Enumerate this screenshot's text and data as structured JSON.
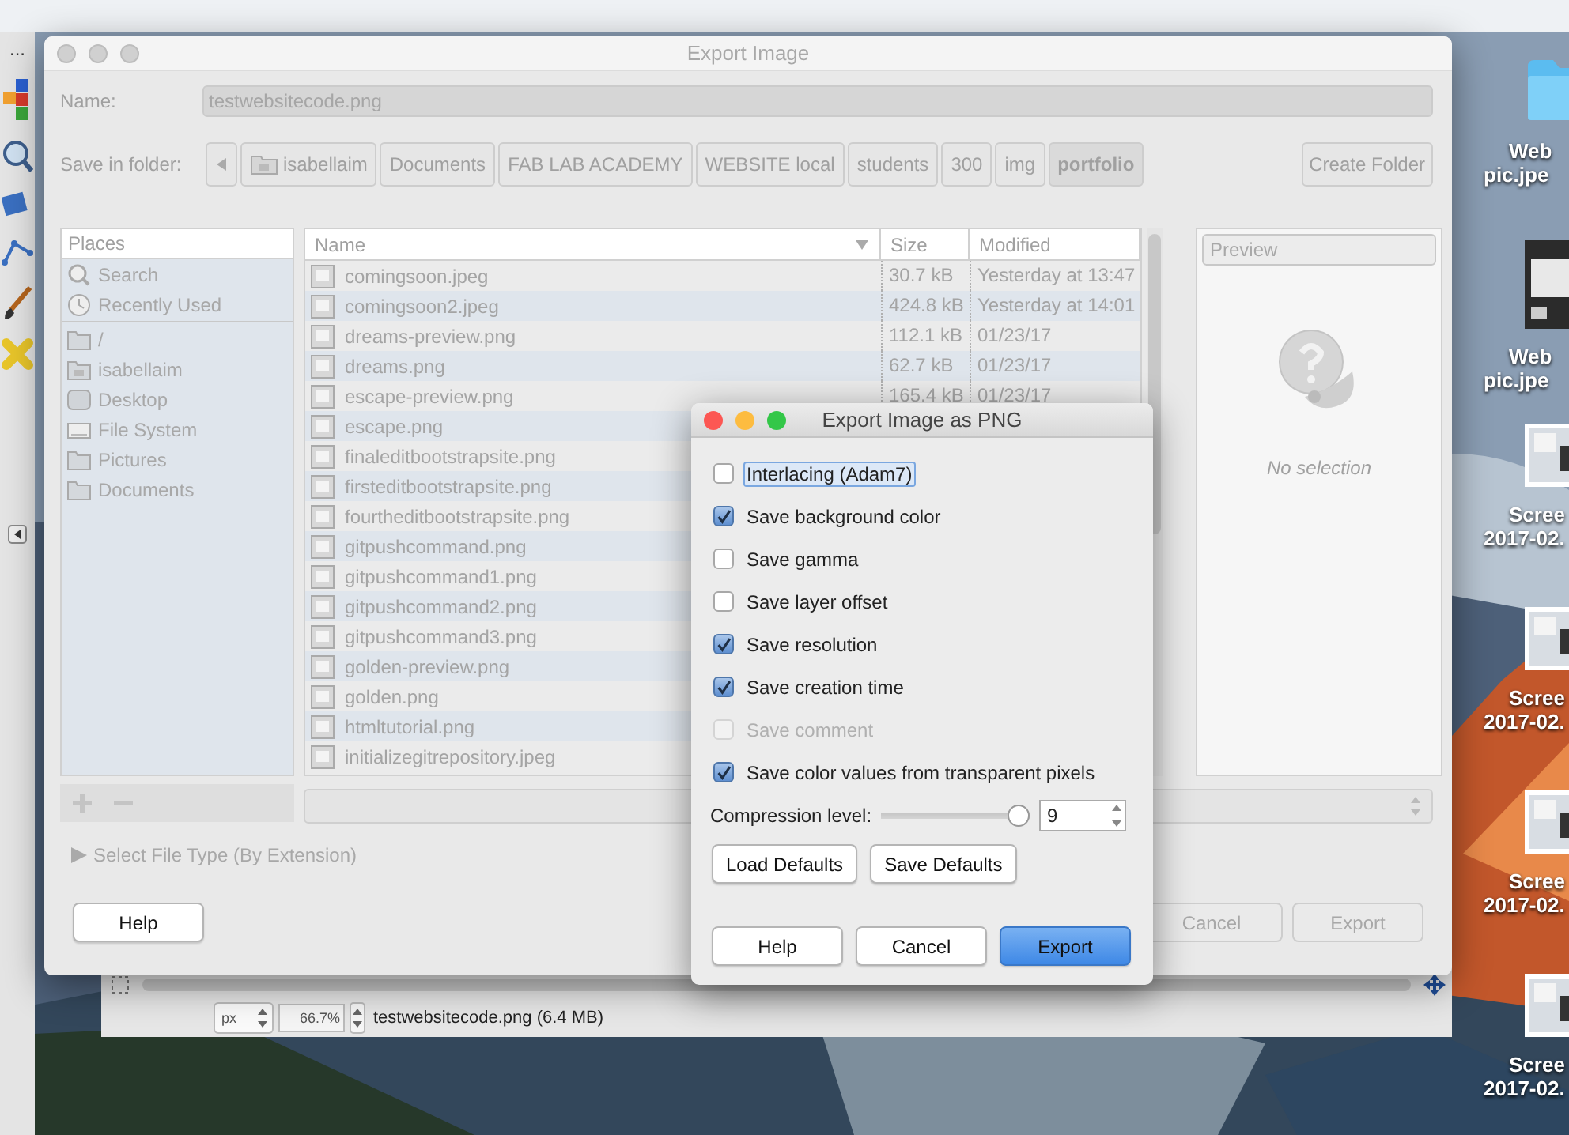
{
  "toolbox": {
    "overflow_label": "..."
  },
  "desktop_icons": [
    {
      "kind": "folder",
      "lines": [
        "Web",
        "pic.jpe"
      ]
    },
    {
      "kind": "dark",
      "lines": [
        "Web",
        "pic.jpe"
      ]
    },
    {
      "kind": "screenshot",
      "lines": [
        "Scree",
        "2017-02."
      ]
    },
    {
      "kind": "screenshot",
      "lines": [
        "Scree",
        "2017-02."
      ]
    },
    {
      "kind": "screenshot",
      "lines": [
        "Scree",
        "2017-02."
      ]
    },
    {
      "kind": "screenshot",
      "lines": [
        "Scree",
        "2017-02."
      ]
    }
  ],
  "image_window": {
    "unit": "px",
    "zoom": "66.7%",
    "status": "testwebsitecode.png (6.4 MB)"
  },
  "export_dialog": {
    "title": "Export Image",
    "name_label": "Name:",
    "name_value": "testwebsitecode.png",
    "folder_label": "Save in folder:",
    "path": [
      {
        "label": "isabellaim",
        "kind": "home",
        "selected": false
      },
      {
        "label": "Documents",
        "kind": "plain",
        "selected": false
      },
      {
        "label": "FAB LAB ACADEMY",
        "kind": "plain",
        "selected": false
      },
      {
        "label": "WEBSITE local",
        "kind": "plain",
        "selected": false
      },
      {
        "label": "students",
        "kind": "plain",
        "selected": false
      },
      {
        "label": "300",
        "kind": "plain",
        "selected": false
      },
      {
        "label": "img",
        "kind": "plain",
        "selected": false
      },
      {
        "label": "portfolio",
        "kind": "plain",
        "selected": true
      }
    ],
    "create_folder": "Create Folder",
    "places": {
      "title": "Places",
      "shortcuts": [
        {
          "label": "Search",
          "kind": "search"
        },
        {
          "label": "Recently Used",
          "kind": "recent"
        }
      ],
      "locations": [
        {
          "label": "/",
          "kind": "folder"
        },
        {
          "label": "isabellaim",
          "kind": "home"
        },
        {
          "label": "Desktop",
          "kind": "desktop"
        },
        {
          "label": "File System",
          "kind": "drive"
        },
        {
          "label": "Pictures",
          "kind": "folder"
        },
        {
          "label": "Documents",
          "kind": "folder"
        }
      ]
    },
    "files": {
      "columns": [
        "Name",
        "Size",
        "Modified"
      ],
      "rows": [
        {
          "name": "comingsoon.jpeg",
          "size": "30.7 kB",
          "modified": "Yesterday at 13:47"
        },
        {
          "name": "comingsoon2.jpeg",
          "size": "424.8 kB",
          "modified": "Yesterday at 14:01"
        },
        {
          "name": "dreams-preview.png",
          "size": "112.1 kB",
          "modified": "01/23/17"
        },
        {
          "name": "dreams.png",
          "size": "62.7 kB",
          "modified": "01/23/17"
        },
        {
          "name": "escape-preview.png",
          "size": "165.4 kB",
          "modified": "01/23/17"
        },
        {
          "name": "escape.png"
        },
        {
          "name": "finaleditbootstrapsite.png"
        },
        {
          "name": "firsteditbootstrapsite.png"
        },
        {
          "name": "fourtheditbootstrapsite.png"
        },
        {
          "name": "gitpushcommand.png"
        },
        {
          "name": "gitpushcommand1.png"
        },
        {
          "name": "gitpushcommand2.png"
        },
        {
          "name": "gitpushcommand3.png"
        },
        {
          "name": "golden-preview.png"
        },
        {
          "name": "golden.png"
        },
        {
          "name": "htmltutorial.png"
        },
        {
          "name": "initializegitrepository.jpeg"
        }
      ]
    },
    "preview": {
      "title": "Preview",
      "message": "No selection"
    },
    "file_type": {
      "label": "Select File Type (By Extension)",
      "expanded": false
    },
    "help": "Help",
    "cancel": "Cancel",
    "export": "Export"
  },
  "png_dialog": {
    "title": "Export Image as PNG",
    "options": [
      {
        "label": "Interlacing (Adam7)",
        "checked": false,
        "disabled": false,
        "focused": true
      },
      {
        "label": "Save background color",
        "checked": true,
        "disabled": false,
        "focused": false
      },
      {
        "label": "Save gamma",
        "checked": false,
        "disabled": false,
        "focused": false
      },
      {
        "label": "Save layer offset",
        "checked": false,
        "disabled": false,
        "focused": false
      },
      {
        "label": "Save resolution",
        "checked": true,
        "disabled": false,
        "focused": false
      },
      {
        "label": "Save creation time",
        "checked": true,
        "disabled": false,
        "focused": false
      },
      {
        "label": "Save comment",
        "checked": false,
        "disabled": true,
        "focused": false
      },
      {
        "label": "Save color values from transparent pixels",
        "checked": true,
        "disabled": false,
        "focused": false
      }
    ],
    "compression": {
      "label": "Compression level:",
      "level": 1,
      "value": "9"
    },
    "defaults": [
      "Load Defaults",
      "Save Defaults"
    ],
    "actions": [
      {
        "label": "Help",
        "default": false
      },
      {
        "label": "Cancel",
        "default": false
      },
      {
        "label": "Export",
        "default": true
      }
    ]
  }
}
